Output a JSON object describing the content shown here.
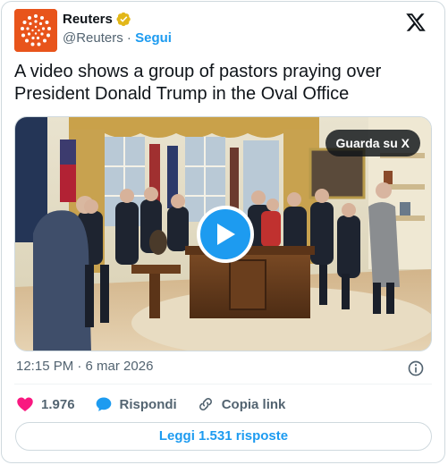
{
  "author": {
    "name": "Reuters",
    "handle": "@Reuters",
    "separator": "·",
    "follow_label": "Segui",
    "avatar_icon": "reuters-dots-logo",
    "verified_color": "#e2b719"
  },
  "platform_icon": "x-logo-icon",
  "tweet": {
    "text": "A video shows a group of pastors praying over President Donald Trump in the Oval Office"
  },
  "media": {
    "overlay_label": "Guarda su X",
    "play_icon": "play-icon"
  },
  "timestamp": "12:15 PM · 6 mar 2026",
  "actions": {
    "likes_count": "1.976",
    "reply_label": "Rispondi",
    "copy_link_label": "Copia link"
  },
  "read_replies_label": "Leggi 1.531 risposte",
  "colors": {
    "accent": "#1d9bf0",
    "like": "#f91880",
    "muted": "#536471",
    "brand": "#e8541b"
  }
}
